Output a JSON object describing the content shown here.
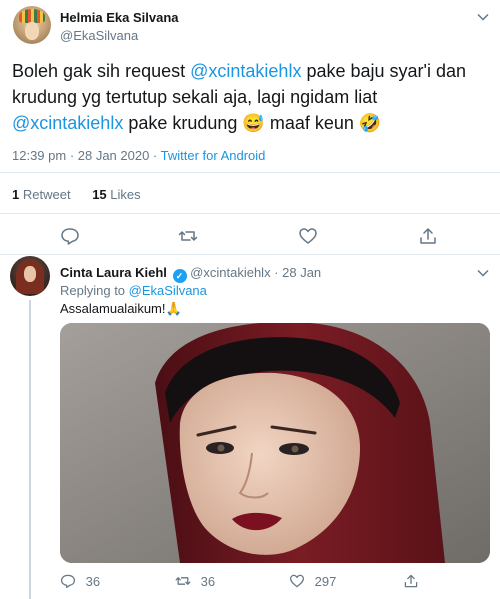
{
  "tweet": {
    "author_name": "Helmia Eka Silvana",
    "author_handle": "@EkaSilvana",
    "text_parts": {
      "p1": "Boleh gak sih request ",
      "m1": "@xcintakiehlx",
      "p2": " pake baju syar'i dan krudung yg tertutup sekali aja, lagi ngidam liat ",
      "m2": "@xcintakiehlx",
      "p3": " pake krudung ",
      "emoji1": "😅",
      "p4": " maaf keun ",
      "emoji2": "🤣"
    },
    "time": "12:39 pm · 28 Jan 2020 · ",
    "source": "Twitter for Android",
    "retweets_count": "1",
    "retweets_label": "Retweet",
    "likes_count": "15",
    "likes_label": "Likes"
  },
  "reply": {
    "author_name": "Cinta Laura Kiehl",
    "author_handle": "@xcintakiehlx · 28 Jan",
    "replying_prefix": "Replying to ",
    "replying_to": "@EkaSilvana",
    "text": "Assalamualaikum!🙏",
    "reply_count": "36",
    "retweet_count": "36",
    "like_count": "297"
  },
  "icons": {
    "more": "chevron-down-icon",
    "reply": "reply-icon",
    "retweet": "retweet-icon",
    "like": "heart-icon",
    "share": "share-icon",
    "verified": "verified-badge-icon"
  },
  "colors": {
    "link": "#1b95e0",
    "muted": "#657786",
    "divider": "#e1e8ed",
    "verified": "#1da1f2"
  }
}
